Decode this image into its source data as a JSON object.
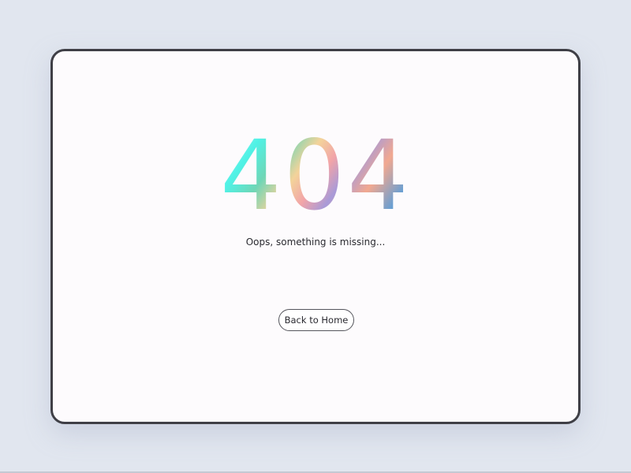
{
  "error": {
    "code": "404",
    "message": "Oops, something is missing..."
  },
  "actions": {
    "home_label": "Back to Home"
  },
  "colors": {
    "page_background": "#e1e6ef",
    "frame_border": "#3f3f46",
    "card_background": "#fdfbfd",
    "text": "#2a2a30",
    "gradient_stops": [
      "#c8f0ee",
      "#4ff2e6",
      "#6fd6b6",
      "#f3d39a",
      "#f2a4a8",
      "#a89ad8",
      "#f2a890",
      "#6a9fd2",
      "#5aa6b9"
    ]
  }
}
